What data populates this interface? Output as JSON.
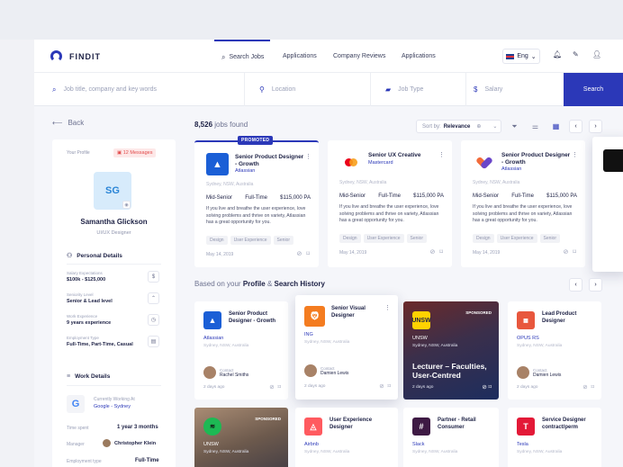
{
  "app": {
    "name": "FINDIT"
  },
  "nav": {
    "search_jobs": "Search Jobs",
    "applications": "Applications",
    "company_reviews": "Company Reviews",
    "applications2": "Applications",
    "language": "Eng"
  },
  "search": {
    "keyword_placeholder": "Job title, company and key words",
    "location_placeholder": "Location",
    "jobtype_placeholder": "Job Type",
    "salary_placeholder": "Salary",
    "button": "Search"
  },
  "back": "Back",
  "profile": {
    "label": "Your Profile",
    "messages": "12 Messages",
    "initials": "SG",
    "name": "Samantha Glickson",
    "role": "UI/UX Designer",
    "personal_title": "Personal Details",
    "details": [
      {
        "key": "Salary Expectations",
        "value": "$100k - $125,000"
      },
      {
        "key": "Seniority Level",
        "value": "Senior & Lead level"
      },
      {
        "key": "Work Experience",
        "value": "9 years experience"
      },
      {
        "key": "Employment Type",
        "value": "Full-Time, Part-Time, Casual"
      }
    ],
    "work_title": "Work Details",
    "current_label": "Currently Working At",
    "current_value": "Google - Sydney",
    "time_label": "Time spent",
    "time_value": "1 year 3 months",
    "manager_label": "Manager",
    "manager_value": "Christopher Klein",
    "emp_label": "Employment type",
    "emp_value": "Full-Time"
  },
  "results": {
    "count": "8,526",
    "suffix": " jobs found",
    "sort_label": "Sort by:",
    "sort_value": "Relevance"
  },
  "promoted": "PROMOTED",
  "jobs": [
    {
      "title": "Senior Product Designer - Growth",
      "company": "Atlassian",
      "location": "Sydney, NSW, Australia",
      "level": "Mid-Senior",
      "type": "Full-Time",
      "salary": "$115,000 PA",
      "desc": "If you live and breathe the user experience, love solving problems and thrive on variety, Atlassian has a great opportunity for you.",
      "tags": [
        "Design",
        "User Experience",
        "Senior"
      ],
      "date": "May 14, 2019"
    },
    {
      "title": "Senior UX Creative",
      "company": "Mastercard",
      "location": "Sydney, NSW, Australia",
      "level": "Mid-Senior",
      "type": "Full-Time",
      "salary": "$115,000 PA",
      "desc": "If you live and breathe the user experience, love solving problems and thrive on variety, Atlassian has a great opportunity for you.",
      "tags": [
        "Design",
        "User Experience",
        "Senior"
      ],
      "date": "May 14, 2019"
    },
    {
      "title": "Senior Product Designer - Growth",
      "company": "Atlassian",
      "location": "Sydney, NSW, Australia",
      "level": "Mid-Senior",
      "type": "Full-Time",
      "salary": "$115,000 PA",
      "desc": "If you live and breathe the user experience, love solving problems and thrive on variety, Atlassian has a great opportunity for you.",
      "tags": [
        "Design",
        "User Experience",
        "Senior"
      ],
      "date": "May 14, 2019"
    }
  ],
  "recommend": {
    "prefix": "Based on your ",
    "profile": "Profile",
    "amp": " & ",
    "history": "Search History"
  },
  "small_jobs": [
    {
      "title": "Senior Product Designer - Growth",
      "company": "Atlassian",
      "location": "Sydney, NSW, Australia",
      "contact_label": "Contact",
      "contact": "Rachel Smiths",
      "date": "2 days ago"
    },
    {
      "title": "Senior Visual Designer",
      "company": "ING",
      "location": "Sydney, NSW, Australia",
      "contact_label": "Contact",
      "contact": "Damien Lewis",
      "date": "2 days ago"
    },
    {
      "title": "Lead Product Designer",
      "company": "OPUS RS",
      "location": "Sydney, NSW, Australia",
      "contact_label": "Contact",
      "contact": "Damien Lewis",
      "date": "2 days ago"
    },
    {
      "title": "User Experience Designer",
      "company": "Airbnb",
      "location": "Sydney, NSW, Australia"
    },
    {
      "title": "Partner - Retail Consumer",
      "company": "Slack",
      "location": "Sydney, NSW, Australia"
    },
    {
      "title": "Service Designer contract/perm",
      "company": "Tesla",
      "location": "Sydney, NSW, Australia"
    }
  ],
  "sponsored": [
    {
      "badge": "SPONSORED",
      "logo": "UNSW",
      "company": "UNSW",
      "location": "Sydney, NSW, Australia",
      "headline": "Lecturer – Faculties, User-Centred",
      "date": "2 days ago"
    },
    {
      "badge": "SPONSORED",
      "company": "UNSW",
      "location": "Sydney, NSW, Australia"
    }
  ],
  "colors": {
    "accent": "#2b38b8",
    "background": "#f5f6fa"
  }
}
